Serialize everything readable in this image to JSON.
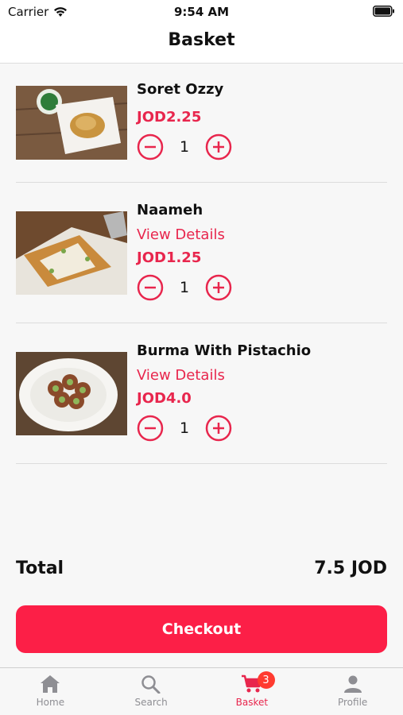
{
  "status_bar": {
    "carrier": "Carrier",
    "time": "9:54 AM"
  },
  "nav": {
    "title": "Basket"
  },
  "items": [
    {
      "name": "Soret Ozzy",
      "details": "",
      "price": "JOD2.25",
      "quantity": "1"
    },
    {
      "name": "Naameh",
      "details": "View Details",
      "price": "JOD1.25",
      "quantity": "1"
    },
    {
      "name": "Burma With Pistachio",
      "details": "View Details",
      "price": "JOD4.0",
      "quantity": "1"
    }
  ],
  "summary": {
    "total_label": "Total",
    "total_value": "7.5 JOD"
  },
  "checkout_label": "Checkout",
  "tabs": [
    {
      "label": "Home",
      "icon": "home-icon"
    },
    {
      "label": "Search",
      "icon": "search-icon"
    },
    {
      "label": "Basket",
      "icon": "cart-icon",
      "badge": "3"
    },
    {
      "label": "Profile",
      "icon": "person-icon"
    }
  ],
  "colors": {
    "accent": "#e8264d",
    "checkout": "#fc1f47",
    "badge": "#ff3b30",
    "tab_inactive": "#8e8e93"
  }
}
